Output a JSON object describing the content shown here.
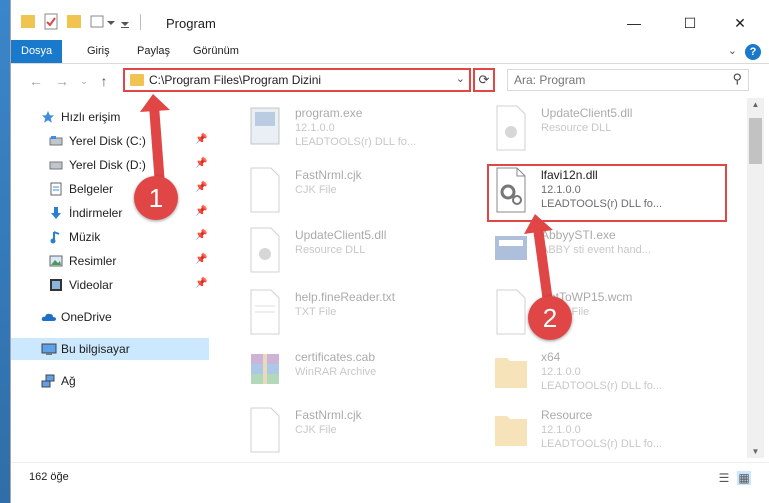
{
  "window": {
    "title": "Program",
    "controls": {
      "minimize": "—",
      "maximize": "☐",
      "close": "✕"
    }
  },
  "ribbon": {
    "tabs": [
      "Dosya",
      "Giriş",
      "Paylaş",
      "Görünüm"
    ],
    "help": "?"
  },
  "nav": {
    "address": "C:\\Program Files\\Program Dizini",
    "search_placeholder": "Ara: Program"
  },
  "sidebar": {
    "items": [
      {
        "label": "Hızlı erişim",
        "icon": "star-icon"
      },
      {
        "label": "Yerel Disk (C:)",
        "icon": "drive-icon"
      },
      {
        "label": "Yerel Disk (D:)",
        "icon": "drive-icon"
      },
      {
        "label": "Belgeler",
        "icon": "documents-icon"
      },
      {
        "label": "İndirmeler",
        "icon": "download-icon"
      },
      {
        "label": "Müzik",
        "icon": "music-icon"
      },
      {
        "label": "Resimler",
        "icon": "pictures-icon"
      },
      {
        "label": "Videolar",
        "icon": "videos-icon"
      },
      {
        "label": "OneDrive",
        "icon": "cloud-icon"
      },
      {
        "label": "Bu bilgisayar",
        "icon": "computer-icon"
      },
      {
        "label": "Ağ",
        "icon": "network-icon"
      }
    ]
  },
  "files": [
    {
      "name": "program.exe",
      "l1": "12.1.0.0",
      "l2": "LEADTOOLS(r) DLL fo..."
    },
    {
      "name": "UpdateClient5.dll",
      "l1": "Resource DLL",
      "l2": ""
    },
    {
      "name": "FastNrml.cjk",
      "l1": "CJK File",
      "l2": ""
    },
    {
      "name": "lfavi12n.dll",
      "l1": "12.1.0.0",
      "l2": "LEADTOOLS(r) DLL fo..."
    },
    {
      "name": "UpdateClient5.dll",
      "l1": "Resource DLL",
      "l2": ""
    },
    {
      "name": "AbbyySTI.exe",
      "l1": "ABBY sti event hand...",
      "l2": ""
    },
    {
      "name": "help.fineReader.txt",
      "l1": "TXT File",
      "l2": ""
    },
    {
      "name": "SetToWP15.wcm",
      "l1": "WCM File",
      "l2": ""
    },
    {
      "name": "certificates.cab",
      "l1": "WinRAR Archive",
      "l2": ""
    },
    {
      "name": "x64",
      "l1": "12.1.0.0",
      "l2": "LEADTOOLS(r) DLL fo..."
    },
    {
      "name": "FastNrml.cjk",
      "l1": "CJK File",
      "l2": ""
    },
    {
      "name": "Resource",
      "l1": "12.1.0.0",
      "l2": "LEADTOOLS(r) DLL fo..."
    }
  ],
  "status": {
    "count": "162 öğe"
  },
  "callouts": [
    "1",
    "2"
  ],
  "colors": {
    "accent": "#1979ca",
    "highlight": "#e04646",
    "selected": "#cce8ff"
  }
}
